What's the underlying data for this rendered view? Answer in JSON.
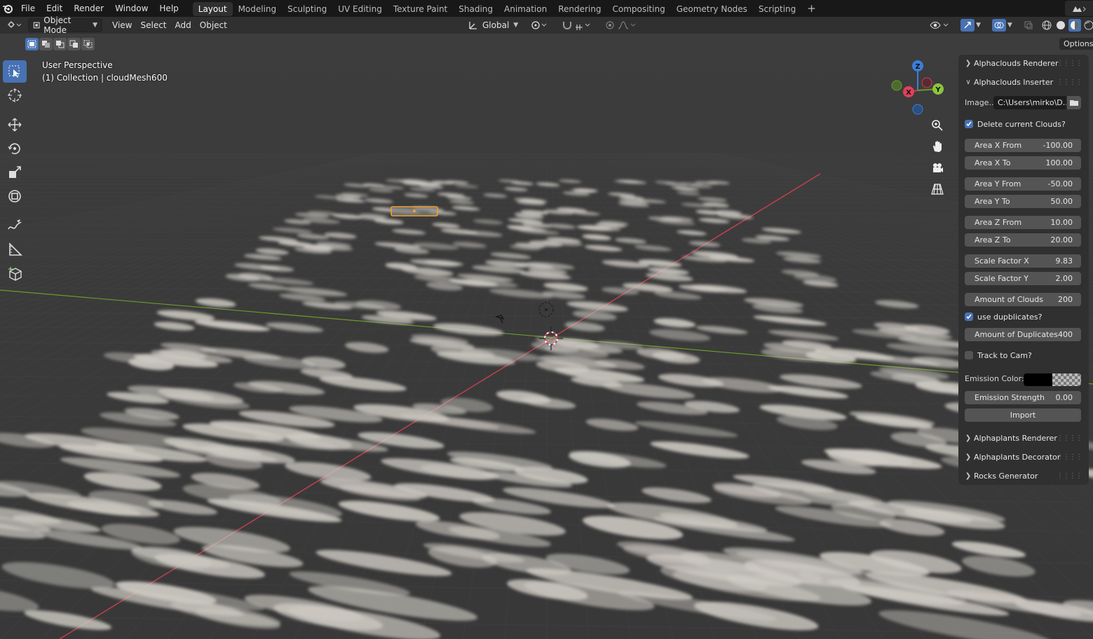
{
  "topbar": {
    "menus": [
      "File",
      "Edit",
      "Render",
      "Window",
      "Help"
    ],
    "workspaces": [
      "Layout",
      "Modeling",
      "Sculpting",
      "UV Editing",
      "Texture Paint",
      "Shading",
      "Animation",
      "Rendering",
      "Compositing",
      "Geometry Nodes",
      "Scripting"
    ],
    "active_workspace": "Layout",
    "add_workspace": "+"
  },
  "header": {
    "mode": "Object Mode",
    "menus": [
      "View",
      "Select",
      "Add",
      "Object"
    ],
    "orientation": "Global",
    "options_label": "Options"
  },
  "viewport": {
    "perspective": "User Perspective",
    "collection": "(1) Collection | cloudMesh600",
    "gizmo_axes": {
      "z": "Z",
      "y": "Y",
      "x": "X"
    }
  },
  "sidebar": {
    "panels_top": [
      {
        "label": "Alphaclouds Renderer",
        "expanded": false
      },
      {
        "label": "Alphaclouds Inserter",
        "expanded": true
      }
    ],
    "image_label": "Image...",
    "image_path": "C:\\Users\\mirko\\D...",
    "delete_clouds": {
      "label": "Delete current Clouds?",
      "checked": true
    },
    "fields": [
      {
        "label": "Area X From",
        "value": "-100.00"
      },
      {
        "label": "Area X To",
        "value": "100.00"
      },
      {
        "label": "Area Y From",
        "value": "-50.00"
      },
      {
        "label": "Area Y To",
        "value": "50.00"
      },
      {
        "label": "Area Z From",
        "value": "10.00"
      },
      {
        "label": "Area Z To",
        "value": "20.00"
      },
      {
        "label": "Scale Factor X",
        "value": "9.83"
      },
      {
        "label": "Scale Factor Y",
        "value": "2.00"
      },
      {
        "label": "Amount of Clouds",
        "value": "200"
      }
    ],
    "use_duplicates": {
      "label": "use dupblicates?",
      "checked": true
    },
    "amount_duplicates": {
      "label": "Amount of Duplicates",
      "value": "400"
    },
    "track_cam": {
      "label": "Track to Cam?",
      "checked": false
    },
    "emission_color_label": "Emission Color:",
    "emission_strength": {
      "label": "Emission Strength",
      "value": "0.00"
    },
    "import_label": "Import",
    "panels_bottom": [
      {
        "label": "Alphaplants Renderer"
      },
      {
        "label": "Alphaplants Decorator"
      },
      {
        "label": "Rocks Generator"
      }
    ]
  },
  "colors": {
    "accent": "#4772b3",
    "x_axis": "#c8404f",
    "y_axis": "#6a9a2a",
    "z_axis": "#3b7fdb",
    "selection": "#f0a030"
  }
}
